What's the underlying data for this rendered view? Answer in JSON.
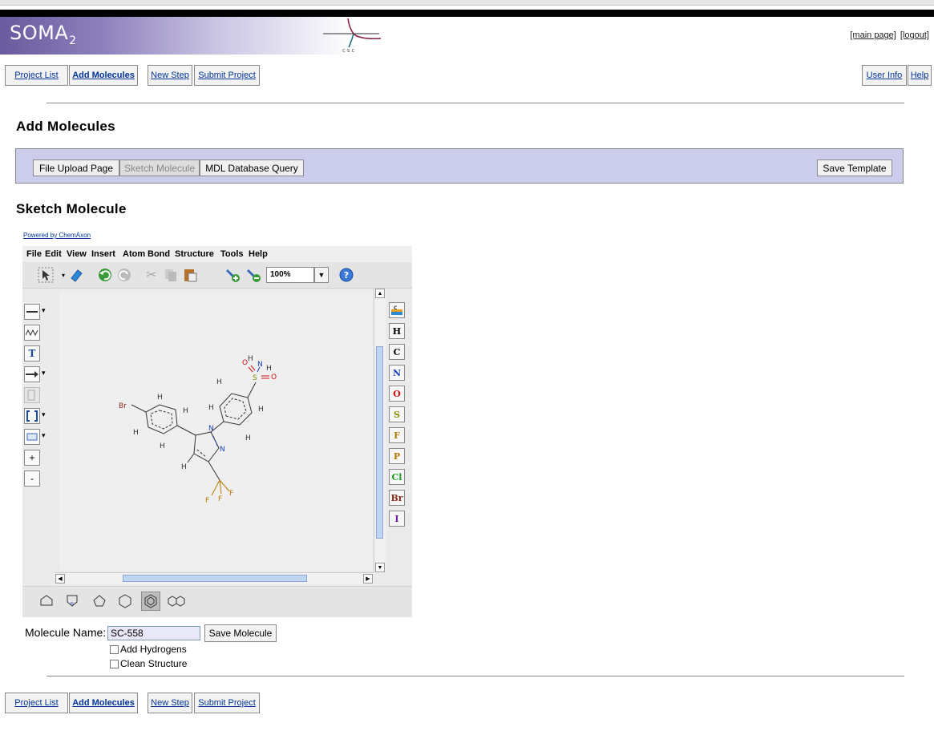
{
  "header": {
    "logo_text": "SOMA",
    "logo_sub": "2",
    "csc_text": "csc",
    "links": [
      "[main page]",
      "[logout]"
    ]
  },
  "nav": {
    "project_list": "Project List",
    "add_molecules": "Add Molecules",
    "new_step": "New Step",
    "submit_project": "Submit Project",
    "user_info": "User Info",
    "help": "Help"
  },
  "page_title": "Add Molecules",
  "subtabs": {
    "file_upload": "File Upload Page",
    "sketch": "Sketch Molecule",
    "mdl_query": "MDL Database Query",
    "active": "Sketch Molecule",
    "save_template": "Save Template"
  },
  "section_title": "Sketch Molecule",
  "powered_by": "Powered by ChemAxon",
  "applet": {
    "menu": [
      "File",
      "Edit",
      "View",
      "Insert",
      "Atom",
      "Bond",
      "Structure",
      "Tools",
      "Help"
    ],
    "zoom": "100%",
    "toolbar_icons": [
      "select-arrow-icon",
      "eraser-icon",
      "undo-icon",
      "redo-icon",
      "cut-icon",
      "copy-icon",
      "paste-icon",
      "zoom-in-icon",
      "zoom-out-icon",
      "help-icon"
    ],
    "left_tools": [
      "single-bond-icon",
      "chain-icon",
      "text-icon",
      "arrow-icon",
      "rgroup-icon",
      "bracket-icon",
      "rectangle-icon",
      "plus-charge-icon",
      "minus-charge-icon"
    ],
    "left_tool_text": [
      "T",
      "+",
      "-"
    ],
    "atoms": [
      "H",
      "C",
      "N",
      "O",
      "S",
      "F",
      "P",
      "Cl",
      "Br",
      "I"
    ],
    "atom_colors": [
      "#333333",
      "#333333",
      "#1e3fb8",
      "#d01010",
      "#8a8a00",
      "#b87a00",
      "#b87a00",
      "#1a9a1a",
      "#8a2a1a",
      "#6a1aa0"
    ],
    "ring_templates": [
      "cyclopentane-icon",
      "pyrrole-icon",
      "cyclopentane-alt-icon",
      "cyclohexane-icon",
      "benzene-icon",
      "naphthalene-icon"
    ],
    "selected_ring": "benzene-icon",
    "molecule_labels": {
      "br": "Br",
      "h": "H",
      "n": "N",
      "s": "S",
      "o": "O",
      "f": "F"
    }
  },
  "form": {
    "molecule_name_label": "Molecule Name:",
    "molecule_name_value": "SC-558",
    "save_button": "Save Molecule",
    "add_hydrogens": "Add Hydrogens",
    "clean_structure": "Clean Structure"
  },
  "colors": {
    "header_purple": "#6a5a9e",
    "subtab_bg": "#ccccec",
    "link_blue": "#003399"
  }
}
